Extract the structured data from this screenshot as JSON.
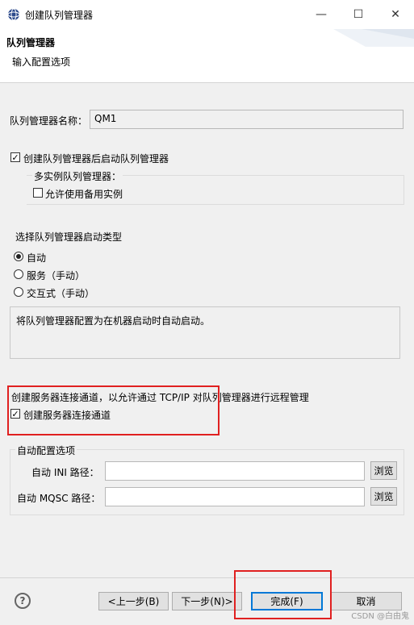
{
  "window": {
    "title": "创建队列管理器",
    "minimize": "—",
    "maximize": "☐",
    "close": "✕"
  },
  "banner": {
    "title": "队列管理器",
    "subtitle": "输入配置选项"
  },
  "qm_name": {
    "label": "队列管理器名称：",
    "value": "QM1"
  },
  "start_after_create": {
    "label": "创建队列管理器后启动队列管理器",
    "checked": true
  },
  "multi_instance": {
    "group_label": "多实例队列管理器：",
    "allow_standby_label": "允许使用备用实例",
    "checked": false
  },
  "startup": {
    "heading": "选择队列管理器启动类型",
    "options": [
      {
        "label": "自动",
        "selected": true
      },
      {
        "label": "服务（手动）",
        "selected": false
      },
      {
        "label": "交互式（手动）",
        "selected": false
      }
    ],
    "description": "将队列管理器配置为在机器启动时自动启动。"
  },
  "channel": {
    "text": "创建服务器连接通道，以允许通过 TCP/IP 对队列管理器进行远程管理",
    "checkbox_label": "创建服务器连接通道",
    "checked": true
  },
  "autoconfig": {
    "group_label": "自动配置选项",
    "ini_label": "自动 INI 路径：",
    "ini_value": "",
    "mqsc_label": "自动 MQSC 路径：",
    "mqsc_value": "",
    "browse_label": "浏览"
  },
  "footer": {
    "help": "?",
    "back": "<上一步(B)",
    "next": "下一步(N)>",
    "finish": "完成(F)",
    "cancel": "取消"
  },
  "watermark": "CSDN @白由鬼"
}
